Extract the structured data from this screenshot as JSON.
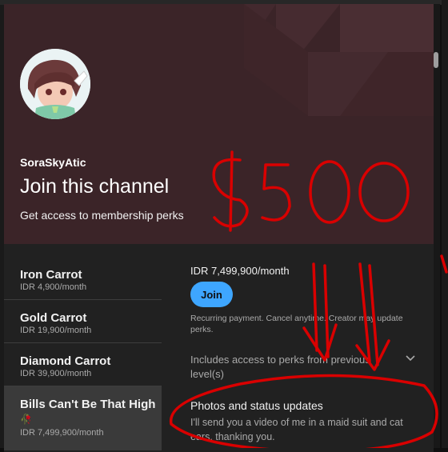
{
  "channel": {
    "name": "SoraSkyAtic"
  },
  "header": {
    "title": "Join this channel",
    "subtitle": "Get access to membership perks"
  },
  "tiers": [
    {
      "name": "Iron Carrot",
      "price": "IDR 4,900/month"
    },
    {
      "name": "Gold Carrot",
      "price": "IDR 19,900/month"
    },
    {
      "name": "Diamond Carrot",
      "price": "IDR 39,900/month"
    },
    {
      "name": "Bills Can't Be That High",
      "emoji": "🥀",
      "price": "IDR 7,499,900/month",
      "selected": true
    }
  ],
  "detail": {
    "price": "IDR 7,499,900/month",
    "join_label": "Join",
    "recurring_note": "Recurring payment. Cancel anytime. Creator may update perks.",
    "includes_text": "Includes access to perks from previous level(s)",
    "perk_title": "Photos and status updates",
    "perk_description": "I'll send you a video of me in a maid suit and cat ears, thanking you."
  },
  "annotation": {
    "handwritten_text": "$500",
    "color": "#d90000"
  },
  "colors": {
    "banner": "#3b2428",
    "accent": "#3ea6ff",
    "modal": "#212121"
  }
}
